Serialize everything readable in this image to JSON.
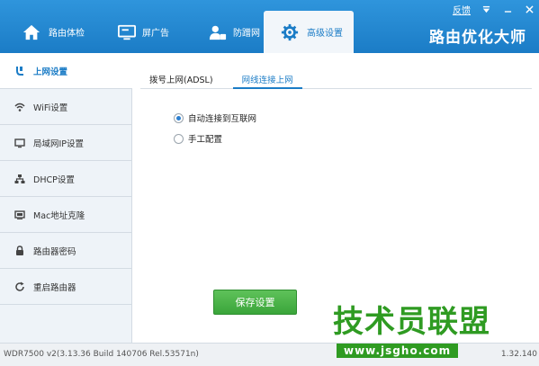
{
  "window": {
    "feedback_label": "反馈",
    "brand_title": "路由优化大师"
  },
  "nav": {
    "items": [
      {
        "label": "路由体检",
        "icon": "home-icon"
      },
      {
        "label": "屏广告",
        "icon": "screen-icon"
      },
      {
        "label": "防蹭网",
        "icon": "user-shield-icon"
      },
      {
        "label": "高级设置",
        "icon": "gear-icon",
        "active": true
      }
    ]
  },
  "sidebar": {
    "items": [
      {
        "label": "上网设置",
        "icon": "plug-icon",
        "active": true
      },
      {
        "label": "WiFi设置",
        "icon": "wifi-icon"
      },
      {
        "label": "局域网IP设置",
        "icon": "monitor-icon"
      },
      {
        "label": "DHCP设置",
        "icon": "network-icon"
      },
      {
        "label": "Mac地址克隆",
        "icon": "mac-icon"
      },
      {
        "label": "路由器密码",
        "icon": "lock-icon"
      },
      {
        "label": "重启路由器",
        "icon": "restart-icon"
      }
    ]
  },
  "tabs": [
    {
      "label": "拨号上网(ADSL)"
    },
    {
      "label": "网线连接上网",
      "active": true
    }
  ],
  "options": {
    "auto_connect_label": "自动连接到互联网",
    "manual_label": "手工配置",
    "selected": "auto"
  },
  "save_label": "保存设置",
  "status": {
    "left": "WDR7500 v2(3.13.36 Build 140706 Rel.53571n)",
    "right": "1.32.140"
  },
  "watermark": {
    "main": "技术员联盟",
    "url": "www.jsgho.com"
  },
  "colors": {
    "header": "#1f86d0",
    "accent": "#1b7cc6",
    "save_button": "#46b043",
    "watermark": "#2f9b22"
  }
}
